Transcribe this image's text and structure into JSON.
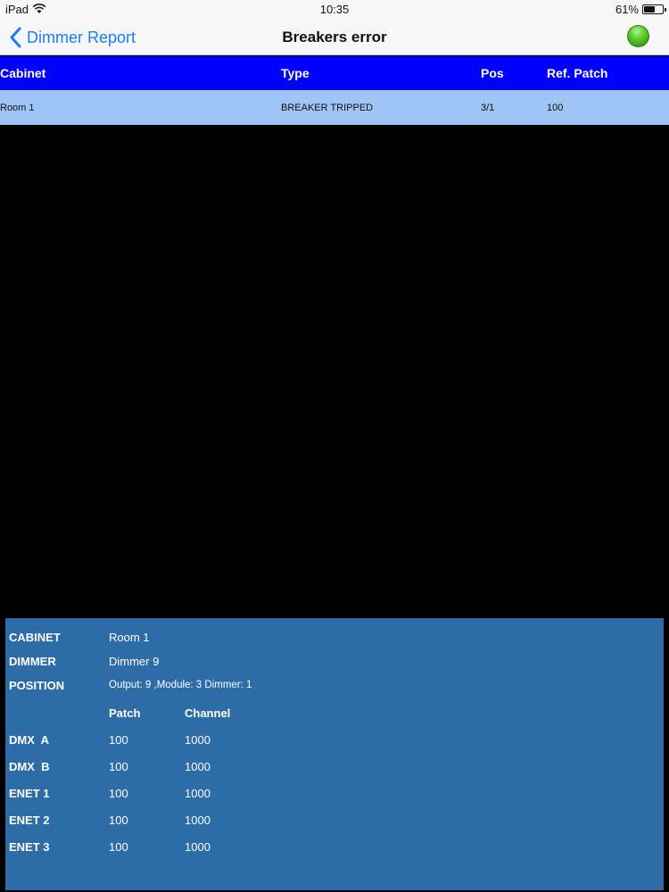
{
  "status_bar": {
    "device": "iPad",
    "time": "10:35",
    "battery": "61%",
    "battery_level": 0.61
  },
  "nav": {
    "back_label": "Dimmer Report",
    "title": "Breakers error",
    "status_color": "#3cb41a"
  },
  "table": {
    "columns": [
      "Cabinet",
      "Type",
      "Pos",
      "Ref. Patch"
    ],
    "rows": [
      {
        "cabinet": "Room 1",
        "type": "BREAKER TRIPPED",
        "pos": "3/1",
        "ref_patch": "100"
      }
    ]
  },
  "detail": {
    "cabinet_label": "CABINET",
    "cabinet_value": "Room 1",
    "dimmer_label": "DIMMER",
    "dimmer_value": "Dimmer 9",
    "position_label": "POSITION",
    "position_value": "Output: 9 ,Module: 3 Dimmer: 1",
    "patch_header": "Patch",
    "channel_header": "Channel",
    "outputs": [
      {
        "name": "DMX  A",
        "patch": "100",
        "channel": "1000"
      },
      {
        "name": "DMX  B",
        "patch": "100",
        "channel": "1000"
      },
      {
        "name": "ENET 1",
        "patch": "100",
        "channel": "1000"
      },
      {
        "name": "ENET 2",
        "patch": "100",
        "channel": "1000"
      },
      {
        "name": "ENET 3",
        "patch": "100",
        "channel": "1000"
      }
    ]
  }
}
